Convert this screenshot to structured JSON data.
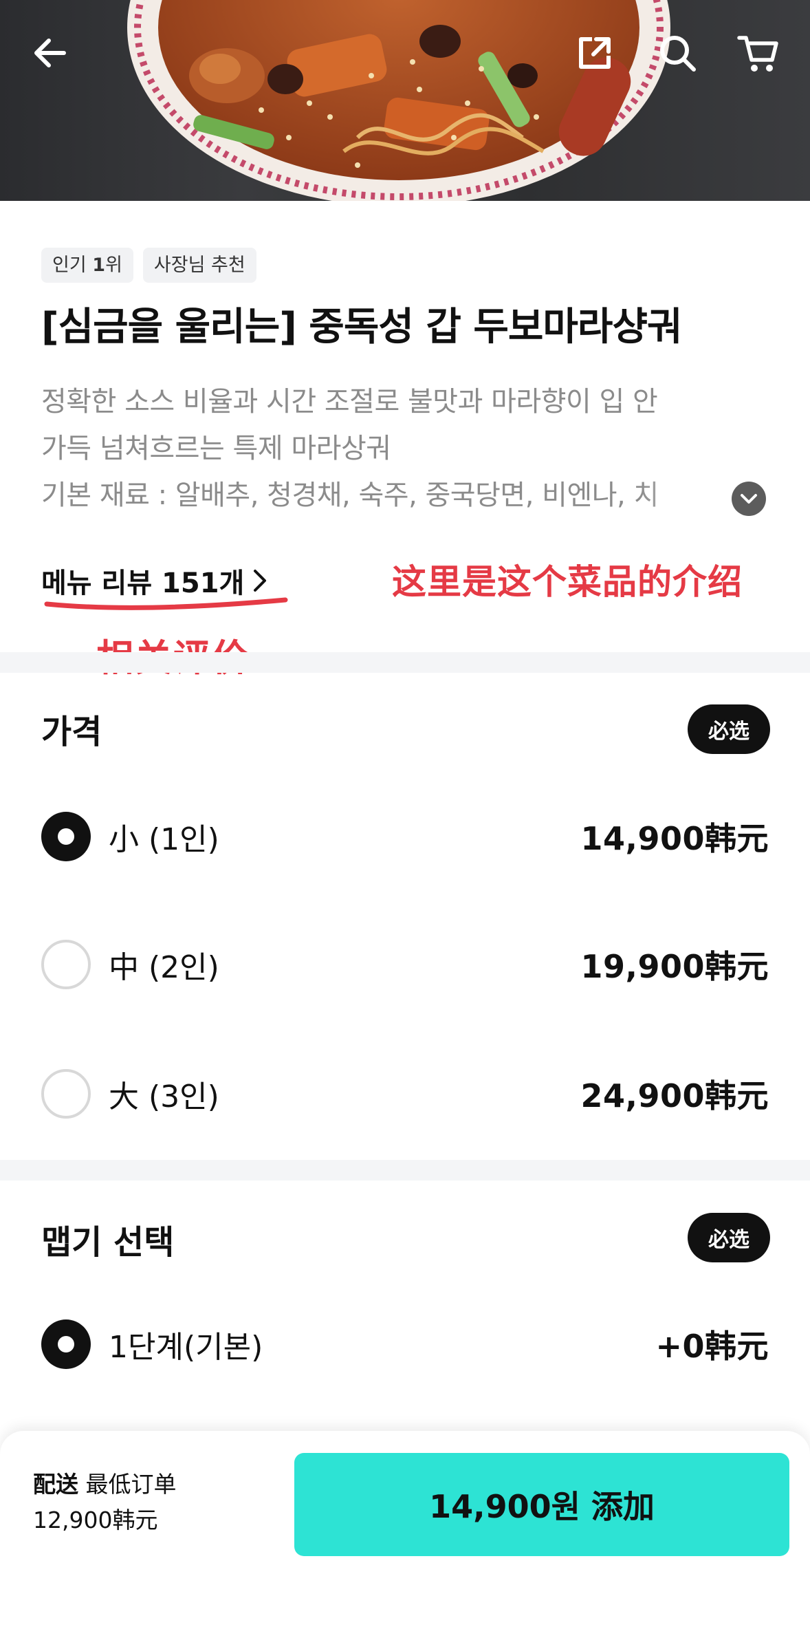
{
  "header": {
    "back_icon": "arrow-left-icon",
    "share_icon": "share-icon",
    "search_icon": "search-icon",
    "cart_icon": "cart-icon"
  },
  "tags": [
    {
      "prefix": "인기 ",
      "strong": "1",
      "suffix": "위"
    },
    {
      "text": "사장님 추천"
    }
  ],
  "title": "[심금을 울리는] 중독성 갑 두보마라샹궈",
  "description": {
    "line1": "정확한 소스 비율과 시간 조절로 불맛과 마라향이 입 안",
    "line2": "가득 넘쳐흐르는 특제 마라상궈",
    "ingredients": "기본 재료 : 알배추, 청경채, 숙주, 중국당면, 비엔나, 치"
  },
  "review_link": {
    "label": "메뉴 리뷰 151개",
    "icon": "chevron-right-icon"
  },
  "annotations": {
    "intro": "这里是这个菜品的介绍",
    "reviews": "相关评价"
  },
  "price_section": {
    "title": "가격",
    "badge": "必选",
    "options": [
      {
        "label": "小 (1인)",
        "price": "14,900韩元",
        "selected": true
      },
      {
        "label": "中 (2인)",
        "price": "19,900韩元",
        "selected": false
      },
      {
        "label": "大 (3인)",
        "price": "24,900韩元",
        "selected": false
      }
    ]
  },
  "spice_section": {
    "title": "맵기 선택",
    "badge": "必选",
    "options": [
      {
        "label": "1단계(기본)",
        "price": "+0韩元",
        "selected": true
      }
    ]
  },
  "bottom_bar": {
    "delivery_label": "配送",
    "min_order_label": "最低订单",
    "min_order_value": "12,900韩元",
    "add_button": "14,900원 添加"
  },
  "colors": {
    "accent": "#2de3d4",
    "annotation": "#e53a45",
    "badge_bg": "#111111"
  }
}
